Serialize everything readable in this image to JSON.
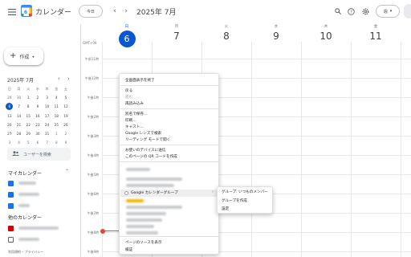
{
  "app": {
    "title": "カレンダー"
  },
  "header": {
    "today_label": "今日",
    "date_label": "2025年 7月",
    "view_label": "週",
    "view_caret": "▾"
  },
  "sidebar": {
    "create_label": "作成",
    "mini_cal": {
      "title": "2025年 7月",
      "weekdays": [
        "日",
        "月",
        "火",
        "水",
        "木",
        "金",
        "土"
      ],
      "weeks": [
        [
          "29",
          "30",
          "1",
          "2",
          "3",
          "4",
          "5"
        ],
        [
          "6",
          "7",
          "8",
          "9",
          "10",
          "11",
          "12"
        ],
        [
          "13",
          "14",
          "15",
          "16",
          "17",
          "18",
          "19"
        ],
        [
          "20",
          "21",
          "22",
          "23",
          "24",
          "25",
          "26"
        ],
        [
          "27",
          "28",
          "29",
          "30",
          "31",
          "1",
          "2"
        ],
        [
          "3",
          "4",
          "5",
          "6",
          "7",
          "8",
          "9"
        ]
      ]
    },
    "search_people": "ユーザーを検索",
    "my_calendars_title": "マイカレンダー",
    "other_calendars_title": "他のカレンダー",
    "footer": "利用規約 – プライバシー"
  },
  "week": {
    "timezone": "GMT+09",
    "days": [
      {
        "dow": "日",
        "num": "6"
      },
      {
        "dow": "月",
        "num": "7"
      },
      {
        "dow": "火",
        "num": "8"
      },
      {
        "dow": "水",
        "num": "9"
      },
      {
        "dow": "木",
        "num": "10"
      },
      {
        "dow": "金",
        "num": "11"
      }
    ],
    "times": [
      "午前11時",
      "午後12時",
      "午後1時",
      "午後2時",
      "午後3時",
      "午後4時",
      "午後5時",
      "午後6時",
      "午後7時",
      "午後8時",
      "午後9時"
    ]
  },
  "context_menu": {
    "items": [
      "全画面表示を終了",
      "戻る",
      "進む",
      "再読み込み",
      "別名で保存...",
      "印刷...",
      "キャスト...",
      "Google レンズで検索",
      "リーディング モードで開く",
      "お使いのデバイスに送信",
      "このページの QR コードを作成",
      "Google カレンダーグループ",
      "ページのソースを表示",
      "検証"
    ],
    "submenu_arrow": "›"
  },
  "submenu": {
    "items": [
      "グループ: いつものメンバー",
      "グループを作成",
      "設定"
    ]
  },
  "colors": {
    "accent": "#0b57d0",
    "now_line": "#ea4335",
    "cal_blue": "#1a73e8",
    "cal_red": "#d50000"
  }
}
